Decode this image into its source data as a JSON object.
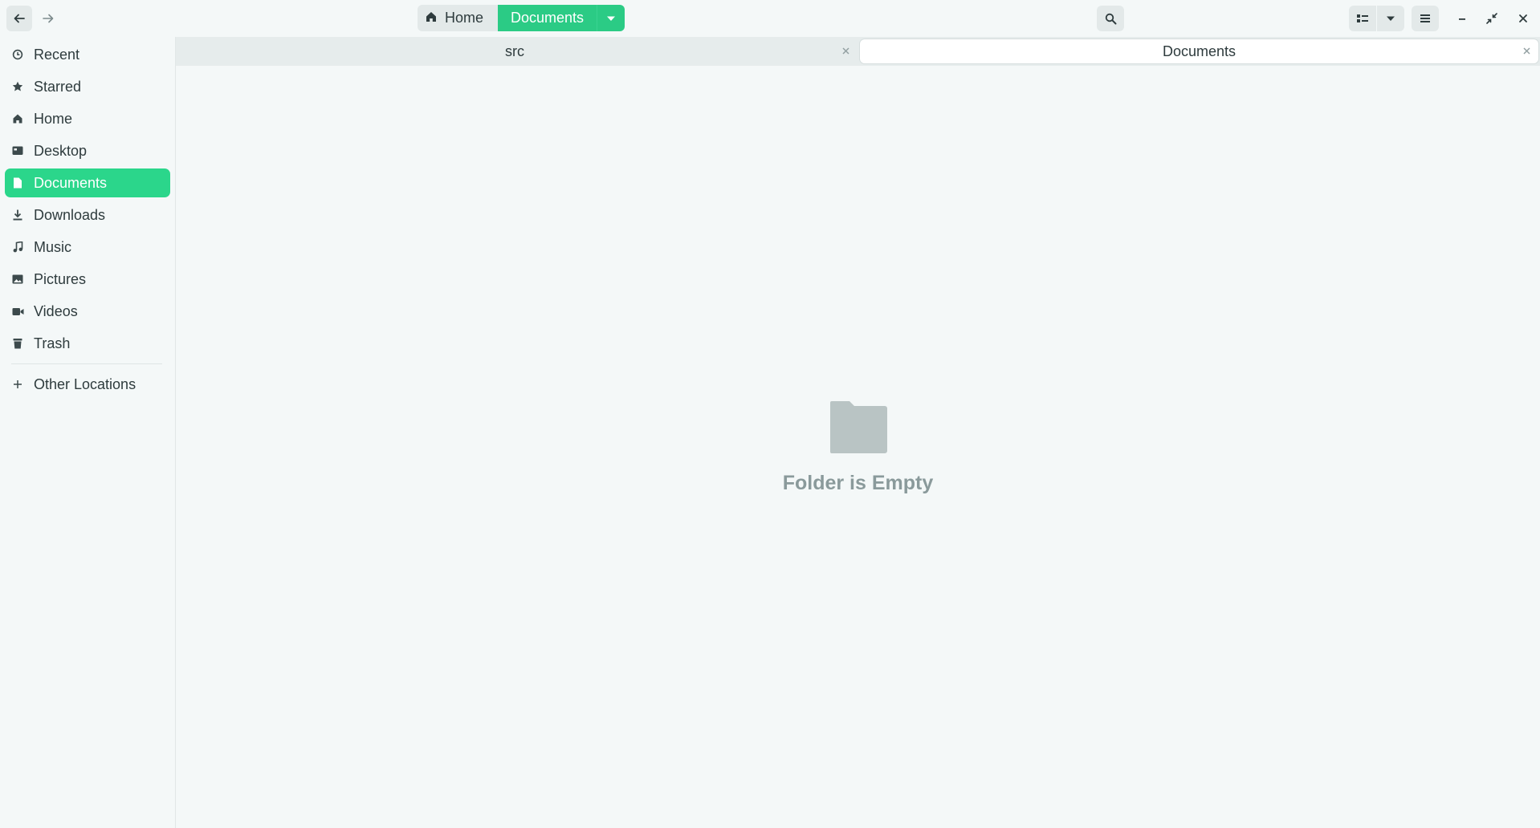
{
  "header": {
    "back_icon": "arrow-left-icon",
    "forward_icon": "arrow-right-icon",
    "path": {
      "home_label": "Home",
      "current_label": "Documents"
    },
    "search_icon": "search-icon",
    "view_icon": "list-view-icon",
    "menu_icon": "hamburger-menu-icon"
  },
  "sidebar": {
    "items": [
      {
        "label": "Recent",
        "icon": "clock-icon"
      },
      {
        "label": "Starred",
        "icon": "star-icon"
      },
      {
        "label": "Home",
        "icon": "home-icon"
      },
      {
        "label": "Desktop",
        "icon": "desktop-icon"
      },
      {
        "label": "Documents",
        "icon": "document-icon",
        "active": true
      },
      {
        "label": "Downloads",
        "icon": "download-icon"
      },
      {
        "label": "Music",
        "icon": "music-icon"
      },
      {
        "label": "Pictures",
        "icon": "picture-icon"
      },
      {
        "label": "Videos",
        "icon": "video-icon"
      },
      {
        "label": "Trash",
        "icon": "trash-icon"
      }
    ],
    "other_locations": {
      "label": "Other Locations",
      "icon": "plus-icon"
    }
  },
  "tabs": [
    {
      "label": "src",
      "active": false
    },
    {
      "label": "Documents",
      "active": true
    }
  ],
  "content": {
    "empty_message": "Folder is Empty",
    "empty_icon": "folder-icon"
  },
  "colors": {
    "accent": "#2bd68b",
    "background": "#f4f8f8",
    "muted_text": "#8a9a9b"
  }
}
